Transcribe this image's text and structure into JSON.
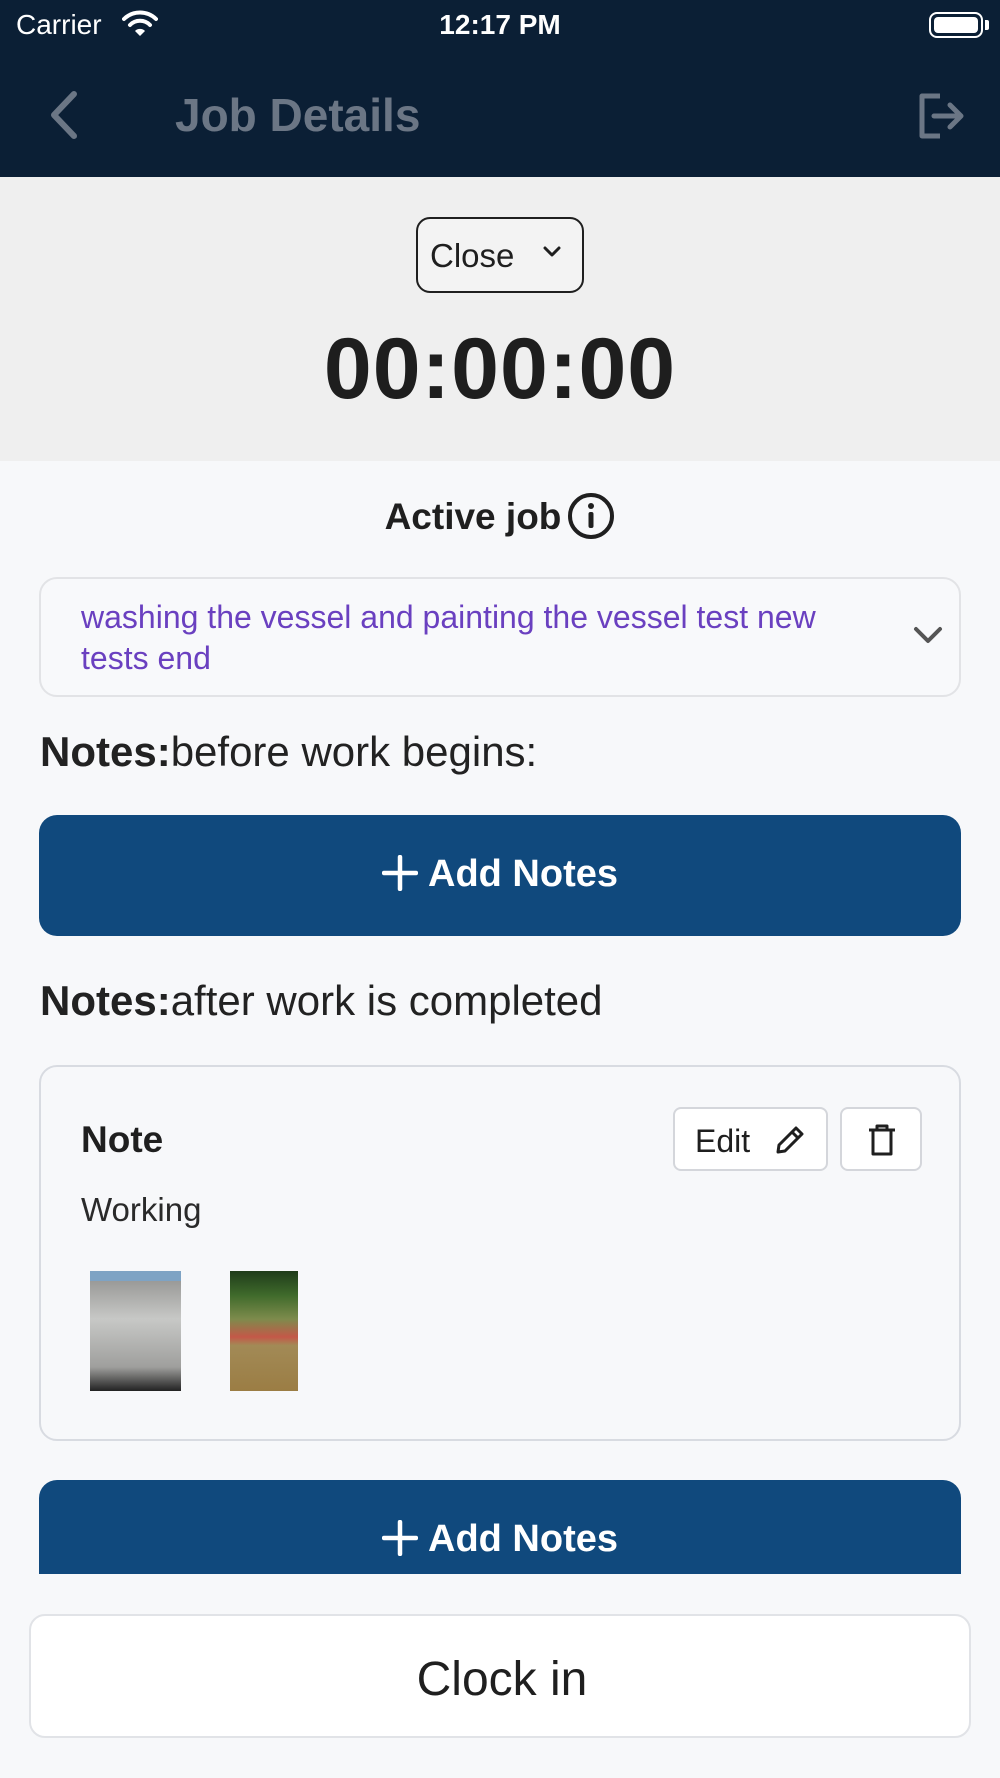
{
  "status_bar": {
    "carrier": "Carrier",
    "time": "12:17 PM"
  },
  "nav": {
    "title": "Job Details",
    "back_icon": "chevron-left-icon",
    "logout_icon": "logout-icon"
  },
  "timer_panel": {
    "status_select": "Close",
    "timer": "00:00:00"
  },
  "active_job": {
    "label": "Active job",
    "selected_job": "washing the vessel and painting the vessel test new tests end"
  },
  "notes_before": {
    "label": "Notes:",
    "subtitle": "before work begins:",
    "add_button": "Add Notes"
  },
  "notes_after": {
    "label": "Notes:",
    "subtitle": "after work is completed",
    "note": {
      "title": "Note",
      "text": "Working",
      "edit_button": "Edit"
    },
    "add_button": "Add Notes"
  },
  "footer": {
    "clock_button": "Clock in"
  },
  "colors": {
    "header": "#0b1f35",
    "primary_button": "#10497d",
    "job_text": "#6a40c0"
  }
}
